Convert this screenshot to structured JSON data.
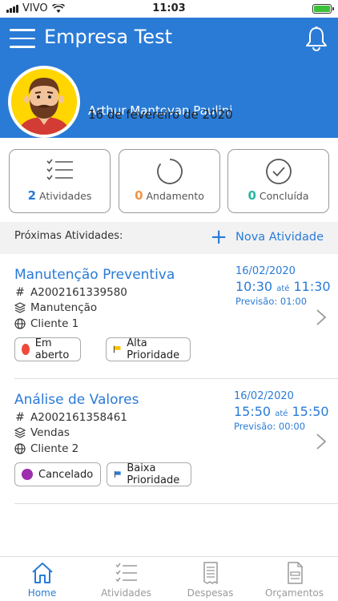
{
  "status_bar": {
    "carrier": "VIVO",
    "time": "11:03"
  },
  "header": {
    "title": "Empresa Test"
  },
  "user": {
    "name": "Arthur Mantovan Paulini",
    "date": "16 de fevereiro de 2020"
  },
  "summary": [
    {
      "count": "2",
      "label": "Atividades",
      "color": "#2a7bd6"
    },
    {
      "count": "0",
      "label": "Andamento",
      "color": "#f0964b"
    },
    {
      "count": "0",
      "label": "Concluída",
      "color": "#26b6a2"
    }
  ],
  "section": {
    "title": "Próximas Atividades:",
    "new_label": "Nova Atividade"
  },
  "activities": [
    {
      "title": "Manutenção Preventiva",
      "code": "A2002161339580",
      "category": "Manutenção",
      "client": "Cliente 1",
      "date": "16/02/2020",
      "start": "10:30",
      "until": "até",
      "end": "11:30",
      "forecast": "Previsão: 01:00",
      "status": "Em aberto",
      "status_color": "#f04a3c",
      "priority": "Alta Prioridade",
      "priority_color": "#f5c400"
    },
    {
      "title": "Análise de Valores",
      "code": "A2002161358461",
      "category": "Vendas",
      "client": "Cliente 2",
      "date": "16/02/2020",
      "start": "15:50",
      "until": "até",
      "end": "15:50",
      "forecast": "Previsão: 00:00",
      "status": "Cancelado",
      "status_color": "#9b2fae",
      "priority": "Baixa Prioridade",
      "priority_color": "#2a7bd6"
    }
  ],
  "tabs": [
    {
      "label": "Home",
      "icon": "home-icon",
      "active": true
    },
    {
      "label": "Atividades",
      "icon": "checklist-icon",
      "active": false
    },
    {
      "label": "Despesas",
      "icon": "receipt-icon",
      "active": false
    },
    {
      "label": "Orçamentos",
      "icon": "document-icon",
      "active": false
    }
  ],
  "colors": {
    "brand": "#2a7bd6",
    "avatar_bg": "#ffd600"
  }
}
